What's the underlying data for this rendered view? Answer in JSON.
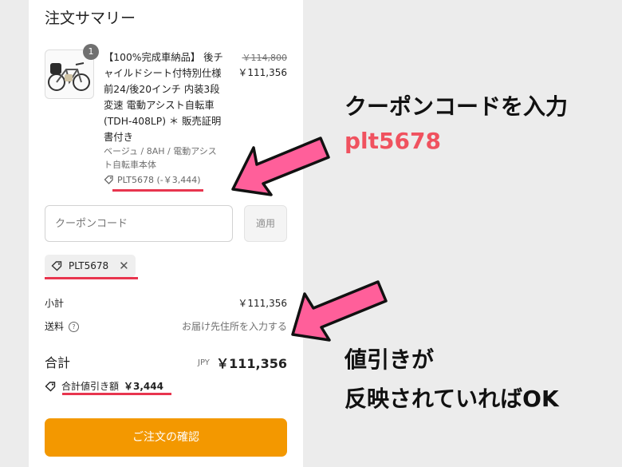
{
  "summary": {
    "title": "注文サマリー",
    "quantity": "1",
    "product_name": "【100%完成車納品】 後チャイルドシート付特別仕様 前24/後20インチ 内装3段変速 電動アシスト自転車 (TDH-408LP) ＊ 販売証明書付き",
    "variant": "ベージュ / 8AH / 電動アシスト自転車本体",
    "applied_coupon": "PLT5678 (-￥3,444)",
    "original_price": "￥114,800",
    "price": "￥111,356"
  },
  "coupon": {
    "placeholder": "クーポンコード",
    "apply_label": "適用",
    "chip_code": "PLT5678"
  },
  "totals": {
    "subtotal_label": "小計",
    "subtotal_value": "￥111,356",
    "shipping_label": "送料",
    "shipping_value": "お届け先住所を入力する",
    "total_label": "合計",
    "currency": "JPY",
    "total_value": "￥111,356",
    "discount_label": "合計値引き額",
    "discount_value": "￥3,444"
  },
  "actions": {
    "confirm_label": "ご注文の確認"
  },
  "annotations": {
    "line1": "クーポンコードを入力",
    "line2": "plt5678",
    "line3": "値引きが",
    "line4": "反映されていればOK"
  },
  "colors": {
    "accent": "#f39800",
    "highlight": "#e8354e",
    "arrow_fill": "#ff5f9a"
  }
}
